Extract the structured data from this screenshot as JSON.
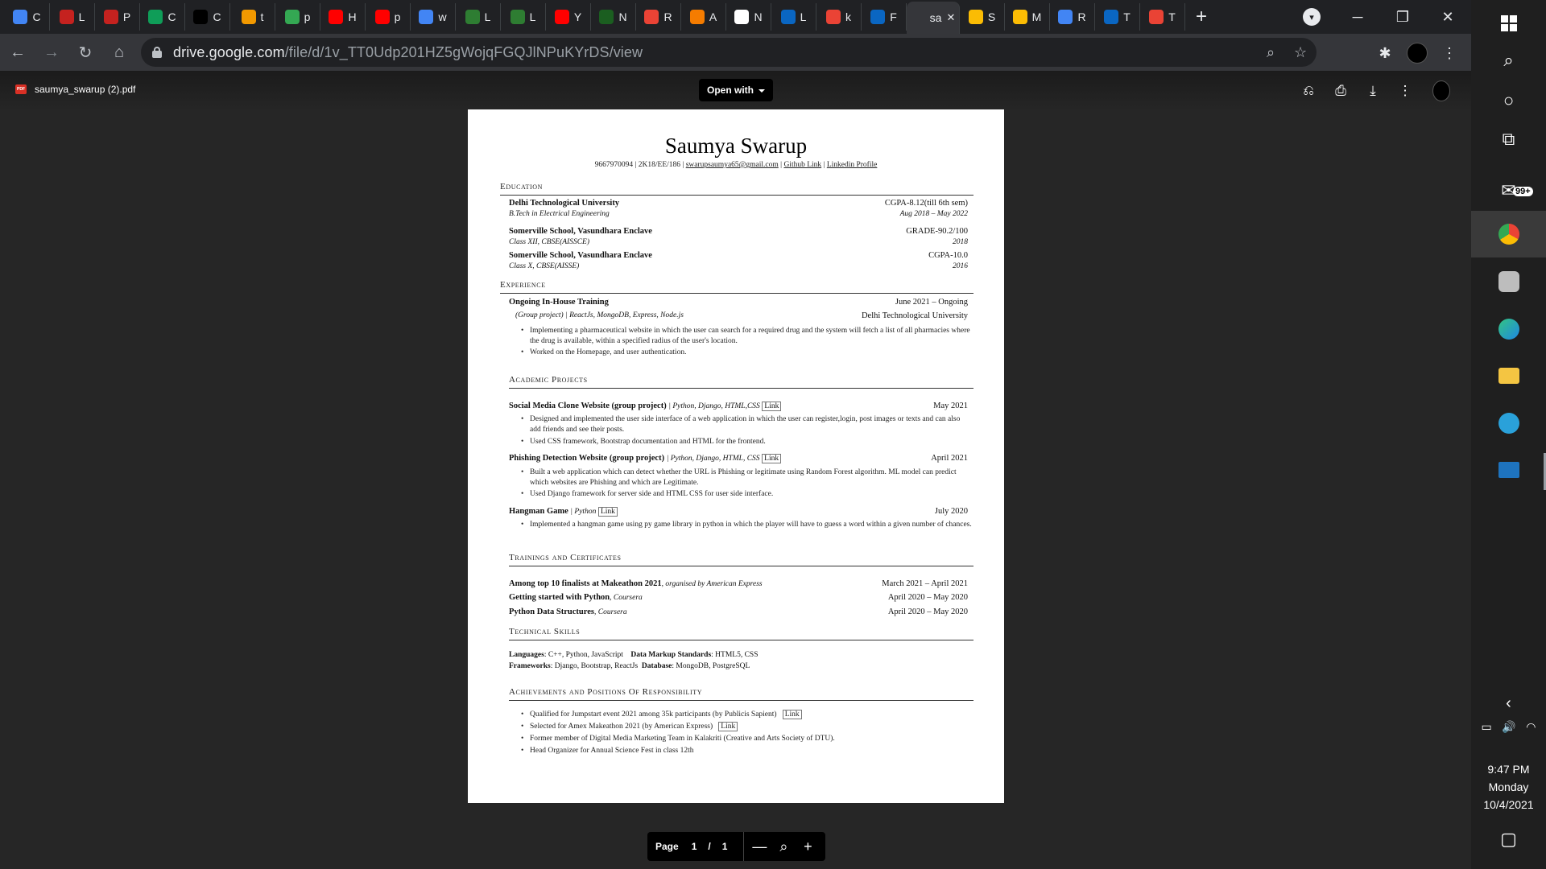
{
  "browser": {
    "tabs": [
      {
        "letter": "C",
        "color": "#4285f4"
      },
      {
        "letter": "L",
        "color": "#c5221f"
      },
      {
        "letter": "P",
        "color": "#c5221f"
      },
      {
        "letter": "C",
        "color": "#0f9d58"
      },
      {
        "letter": "C",
        "color": "#000000"
      },
      {
        "letter": "t",
        "color": "#f29900"
      },
      {
        "letter": "p",
        "color": "#34a853"
      },
      {
        "letter": "H",
        "color": "#ff0000"
      },
      {
        "letter": "p",
        "color": "#ff0000"
      },
      {
        "letter": "w",
        "color": "#4285f4"
      },
      {
        "letter": "L",
        "color": "#2e7d32"
      },
      {
        "letter": "L",
        "color": "#2e7d32"
      },
      {
        "letter": "Y",
        "color": "#ff0000"
      },
      {
        "letter": "N",
        "color": "#1b5e20"
      },
      {
        "letter": "R",
        "color": "#ea4335"
      },
      {
        "letter": "A",
        "color": "#f57c00"
      },
      {
        "letter": "N",
        "color": "#ffffff"
      },
      {
        "letter": "L",
        "color": "#0a66c2"
      },
      {
        "letter": "k",
        "color": "#ea4335"
      },
      {
        "letter": "F",
        "color": "#0a66c2"
      },
      {
        "letter": "sa",
        "color": "#35363a",
        "active": true
      },
      {
        "letter": "S",
        "color": "#fbbc04"
      },
      {
        "letter": "M",
        "color": "#fbbc04"
      },
      {
        "letter": "R",
        "color": "#4285f4"
      },
      {
        "letter": "T",
        "color": "#0a66c2"
      },
      {
        "letter": "T",
        "color": "#ea4335"
      }
    ],
    "new_tab": "+",
    "window": {
      "minimize": "─",
      "restore": "❐",
      "close": "✕"
    },
    "url_host": "drive.google.com",
    "url_path": "/file/d/1v_TT0Udp201HZ5gWojqFGQJlNPuKYrDS/view"
  },
  "viewer": {
    "file_name": "saumya_swarup (2).pdf",
    "file_type": "PDF",
    "open_with": "Open with",
    "page_label": "Page",
    "page_current": "1",
    "page_sep": "/",
    "page_total": "1",
    "zoom_out": "—",
    "zoom_in": "+"
  },
  "resume": {
    "name": "Saumya Swarup",
    "contact_plain": "9667970094 | 2K18/EE/186 |",
    "email": "swarupsaumya65@gmail.com",
    "github": "Github Link",
    "linkedin": "Linkedin Profile",
    "education_title": "Education",
    "edu": [
      {
        "school": "Delhi Technological University",
        "degree": "B.Tech in Electrical Engineering",
        "score": "CGPA-8.12(till 6th sem)",
        "dates": "Aug 2018 – May 2022"
      },
      {
        "school": "Somerville School, Vasundhara Enclave",
        "degree": "Class XII, CBSE(AISSCE)",
        "score": "GRADE-90.2/100",
        "dates": "2018"
      },
      {
        "school": "Somerville School, Vasundhara Enclave",
        "degree": "Class X, CBSE(AISSE)",
        "score": "CGPA-10.0",
        "dates": "2016"
      }
    ],
    "experience_title": "Experience",
    "exp": {
      "role": "Ongoing In-House Training",
      "dates": "June 2021 – Ongoing",
      "stack": "(Group project) | ReactJs, MongoDB, Express, Node.js",
      "org": "Delhi Technological University",
      "b1a": "Implementing a pharmaceutical website in which the user can search for a required drug and the system will fetch a",
      "b1b": "list of all pharmacies where the drug is available, within a specified radius of the user's location.",
      "b2": "Worked on the Homepage, and user authentication."
    },
    "projects_title": "Academic Projects",
    "projects": [
      {
        "name": "Social Media Clone Website (group project)",
        "tech": "| Python, Django, HTML,CSS",
        "link": "Link",
        "date": "May 2021",
        "b1a": "Designed and implemented the user side interface of a web application in which the user can register,login, post",
        "b1b": "images or texts and can also add friends and see their posts.",
        "b2": "Used CSS framework, Bootstrap documentation and HTML for the frontend."
      },
      {
        "name": "Phishing Detection Website (group project)",
        "tech": "| Python, Django, HTML, CSS",
        "link": "Link",
        "date": "April 2021",
        "b1a": "Built a web application which can detect whether the URL is Phishing or legitimate using Random Forest",
        "b1b": "algorithm. ML model can predict which websites are Phishing and which are Legitimate.",
        "b2": "Used Django framework for server side and HTML CSS for user side interface."
      },
      {
        "name": "Hangman Game",
        "tech": "| Python",
        "link": "Link",
        "date": "July 2020",
        "b1a": "Implemented a hangman game using py game library in python in which the player will have to guess a word within",
        "b1b": "a given number of chances."
      }
    ],
    "trainings_title": "Trainings and Certificates",
    "trainings": [
      {
        "name": "Among top 10 finalists at Makeathon 2021",
        "by": ", organised by American Express",
        "dates": "March 2021 – April 2021"
      },
      {
        "name": "Getting started with Python",
        "by": ", Coursera",
        "dates": "April 2020 – May 2020"
      },
      {
        "name": "Python Data Structures",
        "by": ", Coursera",
        "dates": "April 2020 – May 2020"
      }
    ],
    "skills_title": "Technical Skills",
    "skills": {
      "lang_label": "Languages",
      "lang": ": C++, Python, JavaScript",
      "dms_label": "Data Markup Standards",
      "dms": ": HTML5, CSS",
      "fw_label": "Frameworks",
      "fw": ": Django, Bootstrap, ReactJs",
      "db_label": "Database",
      "db": ": MongoDB, PostgreSQL"
    },
    "achievements_title": "Achievements and Positions Of Responsibility",
    "achievements": [
      {
        "text": "Qualified for Jumpstart event 2021 among 35k participants (by Publicis Sapient)",
        "link": "Link"
      },
      {
        "text": "Selected for Amex Makeathon 2021 (by American Express)",
        "link": "Link"
      },
      {
        "text": "Former member of Digital Media Marketing Team in Kalakriti (Creative and Arts Society of DTU)."
      },
      {
        "text": "Head Organizer for Annual Science Fest in class 12th"
      }
    ]
  },
  "taskbar": {
    "mail_badge": "99+",
    "time": "9:47 PM",
    "day": "Monday",
    "date": "10/4/2021"
  }
}
